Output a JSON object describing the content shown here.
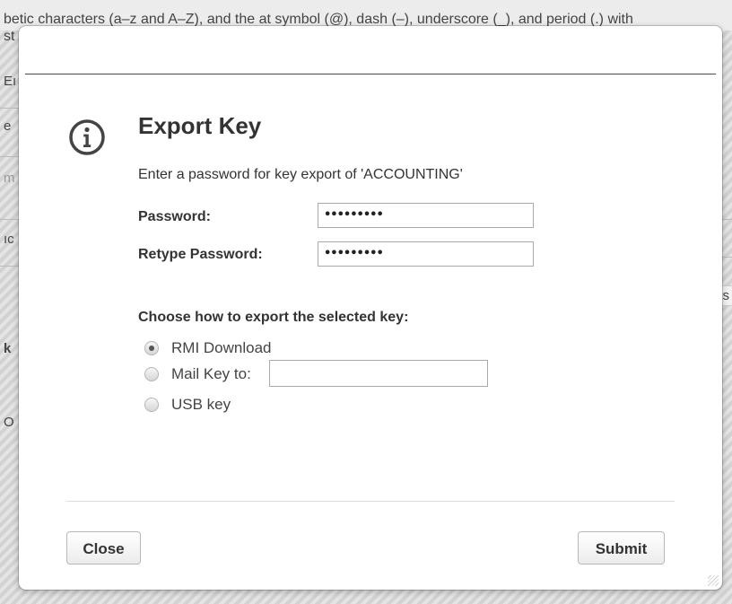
{
  "background": {
    "top_text_line1": "betic characters (a–z and A–Z), and the at symbol (@), dash (–), underscore (_), and period (.) with",
    "top_text_line2": "st",
    "fragments": [
      "Eı",
      "e",
      "m",
      "ıc",
      "k",
      "O"
    ],
    "right_fragment": "s"
  },
  "dialog": {
    "icon": "info-circle-icon",
    "title": "Export Key",
    "intro": "Enter a password for key export of 'ACCOUNTING'",
    "password_label": "Password:",
    "password_value": "•••••••••",
    "retype_label": "Retype Password:",
    "retype_value": "•••••••••",
    "export_section_label": "Choose how to export the selected key:",
    "export_options": [
      {
        "label": "RMI Download",
        "selected": true
      },
      {
        "label": "Mail Key to:",
        "selected": false
      },
      {
        "label": "USB key",
        "selected": false
      }
    ],
    "mail_value": "",
    "close_label": "Close",
    "submit_label": "Submit"
  }
}
